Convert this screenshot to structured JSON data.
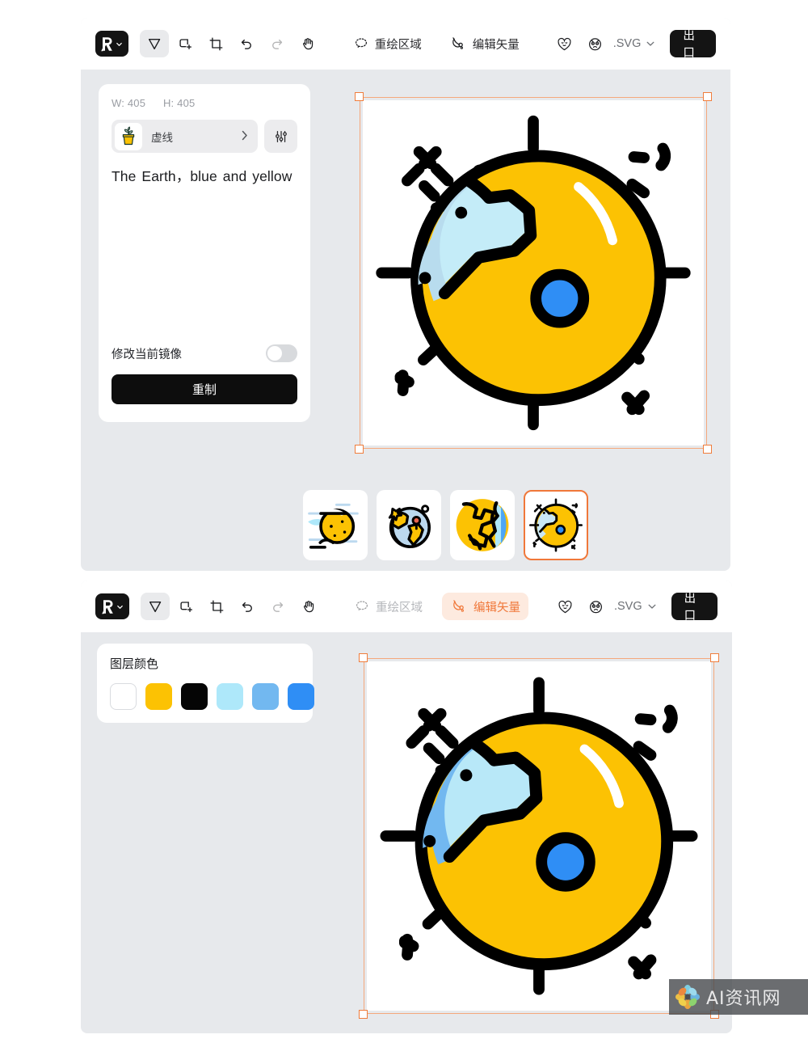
{
  "app": {
    "logo_icon": "recraft-logo-icon",
    "accent": "#f0783a",
    "panel_bg": "#e7e9ec"
  },
  "toolbar_top": {
    "tools": [
      {
        "name": "select-tool",
        "icon": "cursor-arrow-icon",
        "active": true,
        "disabled": false
      },
      {
        "name": "frame-tool",
        "icon": "add-frame-icon",
        "active": false,
        "disabled": false
      },
      {
        "name": "crop-tool",
        "icon": "crop-icon",
        "active": false,
        "disabled": false
      },
      {
        "name": "undo-tool",
        "icon": "undo-icon",
        "active": false,
        "disabled": false
      },
      {
        "name": "redo-tool",
        "icon": "redo-icon",
        "active": false,
        "disabled": true
      },
      {
        "name": "hand-tool",
        "icon": "hand-icon",
        "active": false,
        "disabled": false
      }
    ],
    "inpaint_label": "重绘区域",
    "vector_label": "编辑矢量",
    "heart_icon": "heart-face-icon",
    "face_icon": "surprised-face-icon",
    "format_label": ".SVG",
    "export_label": "出口"
  },
  "toolbar_bottom": {
    "tools": [
      {
        "name": "select-tool",
        "icon": "cursor-arrow-icon",
        "active": true,
        "disabled": false
      },
      {
        "name": "frame-tool",
        "icon": "add-frame-icon",
        "active": false,
        "disabled": false
      },
      {
        "name": "crop-tool",
        "icon": "crop-icon",
        "active": false,
        "disabled": false
      },
      {
        "name": "undo-tool",
        "icon": "undo-icon",
        "active": false,
        "disabled": false
      },
      {
        "name": "redo-tool",
        "icon": "redo-icon",
        "active": false,
        "disabled": true
      },
      {
        "name": "hand-tool",
        "icon": "hand-icon",
        "active": false,
        "disabled": false
      }
    ],
    "inpaint_label": "重绘区域",
    "vector_label": "编辑矢量",
    "vector_active": true,
    "format_label": ".SVG",
    "export_label": "出口"
  },
  "prompt_panel": {
    "width_label": "W: 405",
    "height_label": "H: 405",
    "style_icon": "potted-plant-icon",
    "style_name": "虚线",
    "style_chevron": "chevron-right-icon",
    "settings_icon": "sliders-icon",
    "prompt_text": "The Earth，blue  and  yellow",
    "mirror_label": "修改当前镜像",
    "mirror_enabled": false,
    "regenerate_label": "重制"
  },
  "colors_panel": {
    "title": "图层颜色",
    "swatches": [
      {
        "name": "swatch-white",
        "hex": "#ffffff"
      },
      {
        "name": "swatch-yellow",
        "hex": "#fcc203"
      },
      {
        "name": "swatch-black",
        "hex": "#050505"
      },
      {
        "name": "swatch-light-cyan",
        "hex": "#aee8fa"
      },
      {
        "name": "swatch-sky-blue",
        "hex": "#72b8f0"
      },
      {
        "name": "swatch-vivid-blue",
        "hex": "#2f8ef5"
      }
    ]
  },
  "canvas_top": {
    "selection_color": "#f0783a",
    "art_name": "earth-sun-illustration",
    "continent_fill": "#b8dcee",
    "continent_fill_light": "#c4ecf8",
    "globe_fill": "#fcc203",
    "dot_fill": "#2f8ef5"
  },
  "canvas_bottom": {
    "selection_color": "#f0783a",
    "art_name": "earth-sun-illustration",
    "continent_fill": "#72b8f0",
    "continent_fill_light": "#b8e8f8",
    "globe_fill": "#fcc203",
    "dot_fill": "#2f8ef5"
  },
  "thumbnails": [
    {
      "name": "thumbnail-variant-1",
      "selected": false,
      "variant": "planet-clouds"
    },
    {
      "name": "thumbnail-variant-2",
      "selected": false,
      "variant": "globe-pin"
    },
    {
      "name": "thumbnail-variant-3",
      "selected": false,
      "variant": "globe-continents"
    },
    {
      "name": "thumbnail-variant-4",
      "selected": true,
      "variant": "earth-sun"
    }
  ],
  "watermark": {
    "text": "AI资讯网",
    "logo_icon": "flower-logo-icon"
  }
}
